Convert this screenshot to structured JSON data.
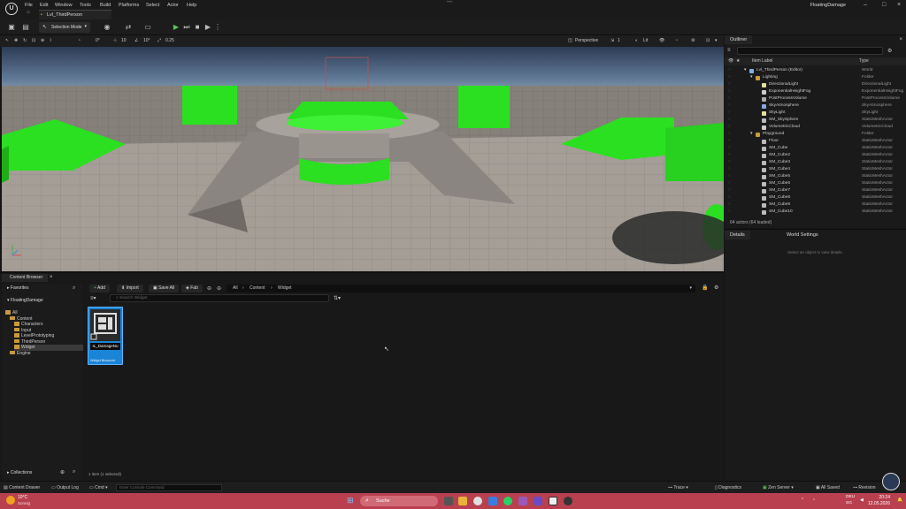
{
  "window": {
    "project_name": "FloatingDamage",
    "tab_title": "Lvl_ThirdPerson"
  },
  "menu": [
    "File",
    "Edit",
    "Window",
    "Tools",
    "Build",
    "Platforms",
    "Select",
    "Actor",
    "Help"
  ],
  "toolbar": {
    "selection_mode": "Selection Mode"
  },
  "viewport_bar": {
    "grid_value": "10",
    "rotation_value": "10°",
    "scale_value": "0.25",
    "angle_value": "0°",
    "perspective": "Perspective",
    "lit": "Lit",
    "camera_speed": "1"
  },
  "outliner": {
    "tab": "Outliner",
    "col_label": "Item Label",
    "col_type": "Type",
    "rows": [
      {
        "label": "Lvl_ThirdPerson (Editor)",
        "type": "World",
        "indent": 0,
        "kind": "world"
      },
      {
        "label": "Lighting",
        "type": "Folder",
        "indent": 1,
        "kind": "folder"
      },
      {
        "label": "DirectionalLight",
        "type": "DirectionalLight",
        "indent": 2,
        "kind": "light"
      },
      {
        "label": "ExponentialHeightFog",
        "type": "ExponentialHeightFog",
        "indent": 2,
        "kind": "fog"
      },
      {
        "label": "PostProcessVolume",
        "type": "PostProcessVolume",
        "indent": 2,
        "kind": "volume"
      },
      {
        "label": "SkyAtmosphere",
        "type": "SkyAtmosphere",
        "indent": 2,
        "kind": "sky"
      },
      {
        "label": "SkyLight",
        "type": "SkyLight",
        "indent": 2,
        "kind": "light"
      },
      {
        "label": "SM_SkySphere",
        "type": "StaticMeshActor",
        "indent": 2,
        "kind": "mesh"
      },
      {
        "label": "VolumetricCloud",
        "type": "VolumetricCloud",
        "indent": 2,
        "kind": "cloud"
      },
      {
        "label": "Playground",
        "type": "Folder",
        "indent": 1,
        "kind": "folder"
      },
      {
        "label": "Floor",
        "type": "StaticMeshActor",
        "indent": 2,
        "kind": "mesh"
      },
      {
        "label": "SM_Cube",
        "type": "StaticMeshActor",
        "indent": 2,
        "kind": "mesh"
      },
      {
        "label": "SM_Cube2",
        "type": "StaticMeshActor",
        "indent": 2,
        "kind": "mesh"
      },
      {
        "label": "SM_Cube3",
        "type": "StaticMeshActor",
        "indent": 2,
        "kind": "mesh"
      },
      {
        "label": "SM_Cube4",
        "type": "StaticMeshActor",
        "indent": 2,
        "kind": "mesh"
      },
      {
        "label": "SM_Cube5",
        "type": "StaticMeshActor",
        "indent": 2,
        "kind": "mesh"
      },
      {
        "label": "SM_Cube6",
        "type": "StaticMeshActor",
        "indent": 2,
        "kind": "mesh"
      },
      {
        "label": "SM_Cube7",
        "type": "StaticMeshActor",
        "indent": 2,
        "kind": "mesh"
      },
      {
        "label": "SM_Cube8",
        "type": "StaticMeshActor",
        "indent": 2,
        "kind": "mesh"
      },
      {
        "label": "SM_Cube9",
        "type": "StaticMeshActor",
        "indent": 2,
        "kind": "mesh"
      },
      {
        "label": "SM_Cube10",
        "type": "StaticMeshActor",
        "indent": 2,
        "kind": "mesh"
      }
    ],
    "footer": "64 actors (64 loaded)"
  },
  "details": {
    "tab": "Details",
    "tab2": "World Settings",
    "empty_message": "Select an object to view details."
  },
  "content_browser": {
    "tab": "Content Browser",
    "favorites": "Favorites",
    "project": "FloatingDamage",
    "tree": [
      {
        "label": "All",
        "indent": 0
      },
      {
        "label": "Content",
        "indent": 1
      },
      {
        "label": "Characters",
        "indent": 2
      },
      {
        "label": "Input",
        "indent": 2
      },
      {
        "label": "LevelPrototyping",
        "indent": 2
      },
      {
        "label": "ThirdPerson",
        "indent": 2
      },
      {
        "label": "Widget",
        "indent": 2,
        "selected": true
      },
      {
        "label": "Engine",
        "indent": 1
      }
    ],
    "collections": "Collections",
    "add": "Add",
    "import": "Import",
    "save_all": "Save All",
    "fab": "Fab",
    "path": [
      "All",
      "Content",
      "Widget"
    ],
    "search_placeholder": "Search Widget",
    "asset_name": "IL_DamageNu",
    "asset_type": "Widget Blueprint",
    "status": "1 item (1 selected)"
  },
  "statusbar": {
    "content_drawer": "Content Drawer",
    "output_log": "Output Log",
    "cmd": "Cmd",
    "cmd_placeholder": "Enter Console Command",
    "trace": "Trace",
    "diagnostics": "Diagnostics",
    "zen_server": "Zen Server",
    "all_saved": "All Saved",
    "revision_control": "Revision"
  },
  "taskbar": {
    "weather_temp": "10°C",
    "weather_desc": "Sonnig",
    "search": "Suche",
    "lang": "DEU",
    "lang2": "SG",
    "time": "20:24",
    "date": "12.05.2026"
  },
  "colors": {
    "accent_green": "#22e01a",
    "selection_blue": "#1a84d6",
    "taskbar": "#b9404f"
  }
}
